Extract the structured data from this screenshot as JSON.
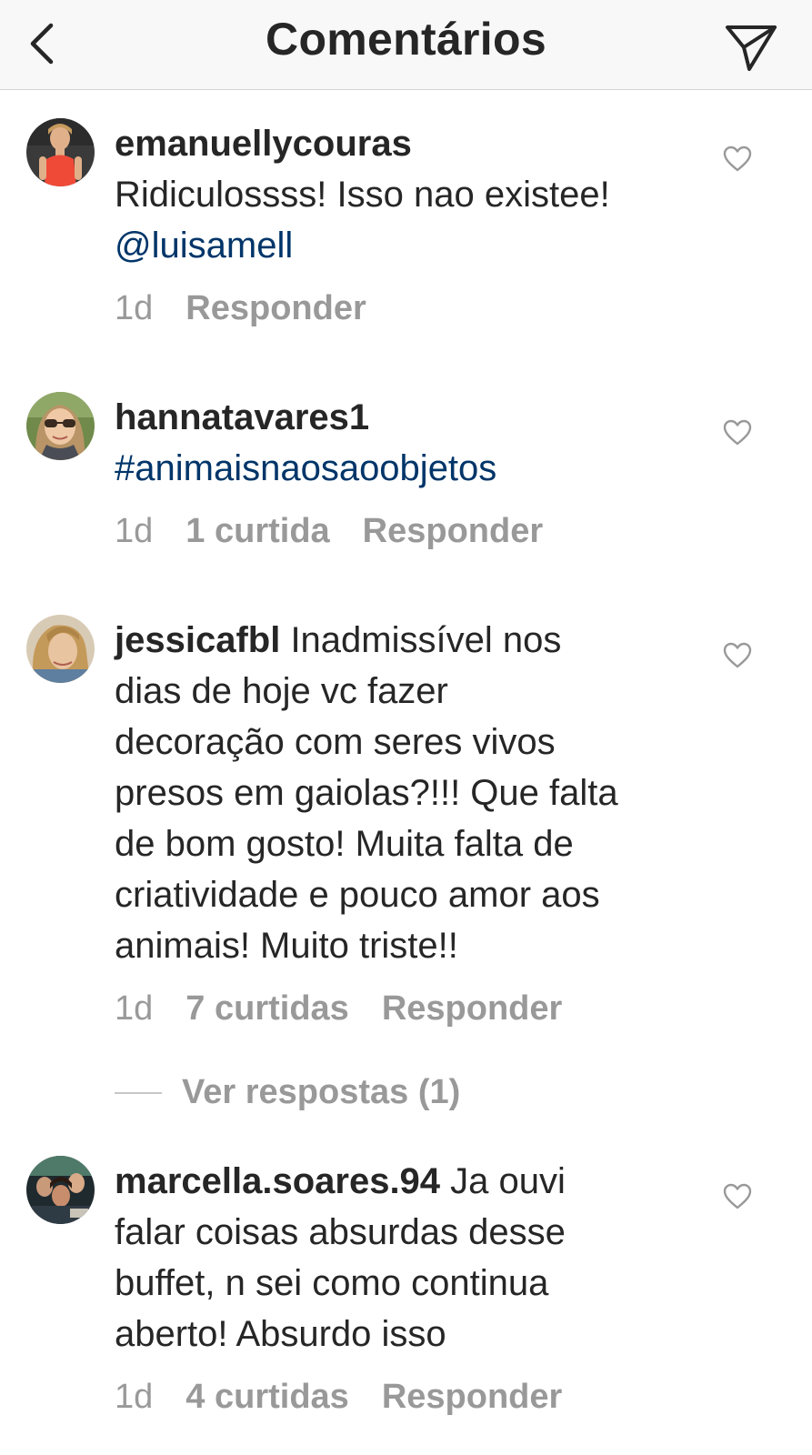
{
  "header": {
    "title": "Comentários",
    "back_icon": "chevron-left-icon",
    "send_icon": "paper-plane-icon"
  },
  "colors": {
    "text": "#262626",
    "meta": "#999999",
    "link": "#003569",
    "header_bg": "#f8f8f8"
  },
  "comments": [
    {
      "username": "emanuellycouras",
      "text_lines": [
        "Ridiculossss! Isso nao existee!"
      ],
      "mention": "@luisamell",
      "time": "1d",
      "reply_label": "Responder"
    },
    {
      "username": "hannatavares1",
      "hashtag": "#animaisnaosaoobjetos",
      "time": "1d",
      "likes": "1 curtida",
      "reply_label": "Responder"
    },
    {
      "username": "jessicafbl",
      "text_first": " Inadmissível nos",
      "text_lines": [
        "dias de hoje vc fazer",
        "decoração com seres vivos",
        "presos em gaiolas?!!! Que falta",
        "de bom gosto! Muita falta de",
        "criatividade e pouco amor aos",
        "animais!  Muito triste!!"
      ],
      "time": "1d",
      "likes": "7 curtidas",
      "reply_label": "Responder",
      "view_replies": "Ver respostas (1)"
    },
    {
      "username": "marcella.soares.94",
      "text_first": " Ja ouvi",
      "text_lines": [
        "falar coisas absurdas desse",
        "buffet, n sei como continua",
        "aberto! Absurdo isso"
      ],
      "time": "1d",
      "likes": "4 curtidas",
      "reply_label": "Responder"
    }
  ]
}
